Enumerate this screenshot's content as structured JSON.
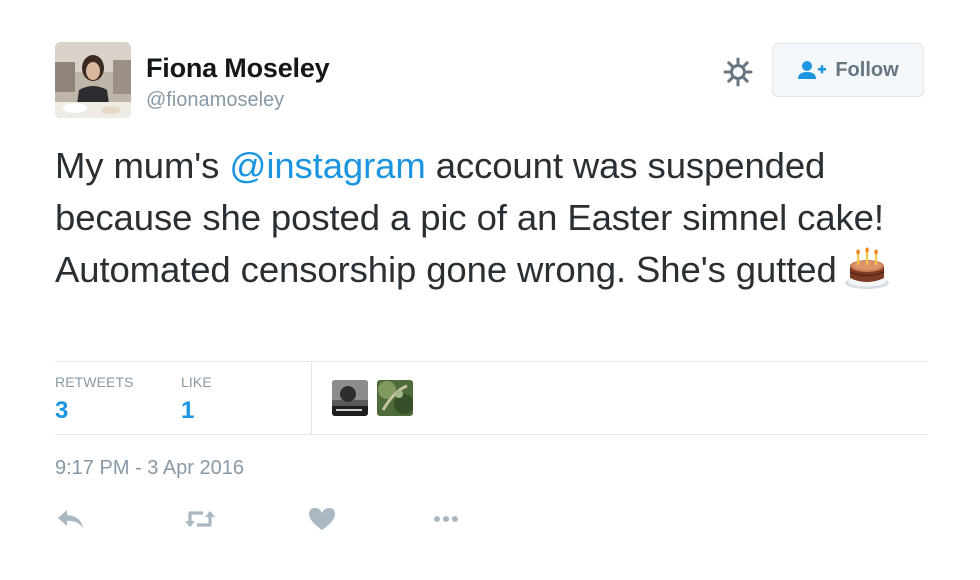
{
  "user": {
    "name": "Fiona Moseley",
    "handle": "@fionamoseley"
  },
  "follow_button": {
    "label": "Follow",
    "icon": "follow-user-icon"
  },
  "tweet": {
    "text_before_mention": "My mum's ",
    "mention": "@instagram",
    "text_after_mention": " account was suspended because she posted a pic of an Easter simnel cake! Automated censorship gone wrong. She's gutted",
    "emoji": "birthday-cake-emoji"
  },
  "stats": {
    "retweets_label": "RETWEETS",
    "retweets_value": "3",
    "likes_label": "LIKE",
    "likes_value": "1"
  },
  "timestamp": "9:17 PM - 3 Apr 2016",
  "actions": [
    "reply-icon",
    "retweet-icon",
    "like-icon",
    "more-icon"
  ],
  "colors": {
    "link": "#1b95e0",
    "muted": "#8899a6",
    "text": "#292f33",
    "icon": "#aab8c2"
  }
}
